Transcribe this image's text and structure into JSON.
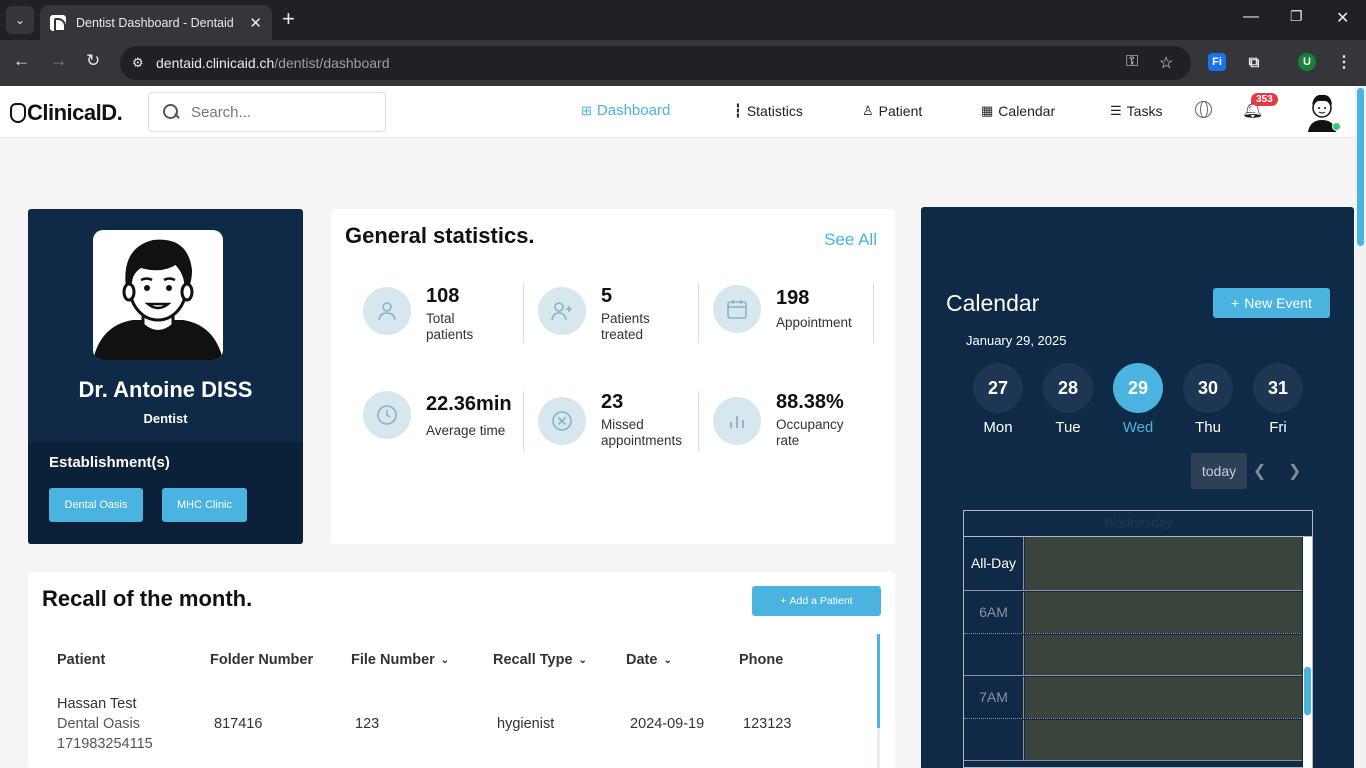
{
  "browser": {
    "tab_title": "Dentist Dashboard - Dentaid",
    "url_host": "dentaid.clinicaid.ch",
    "url_path": "/dentist/dashboard",
    "profile_initial": "U",
    "ext_label": "Fi"
  },
  "header": {
    "logo": "ClinicalD.",
    "search_placeholder": "Search...",
    "nav": [
      "Dashboard",
      "Statistics",
      "Patient",
      "Calendar",
      "Tasks"
    ],
    "notifications": "353"
  },
  "profile": {
    "name": "Dr. Antoine DISS",
    "role": "Dentist",
    "establishments_title": "Establishment(s)",
    "establishments": [
      "Dental Oasis",
      "MHC Clinic"
    ]
  },
  "stats": {
    "title": "General statistics.",
    "see_all": "See All",
    "items": [
      {
        "value": "108",
        "label": "Total patients",
        "icon": "user-icon"
      },
      {
        "value": "5",
        "label": "Patients treated",
        "icon": "user-plus-icon"
      },
      {
        "value": "198",
        "label": "Appointment",
        "icon": "calendar-icon"
      },
      {
        "value": "22.36min",
        "label": "Average time",
        "icon": "clock-icon"
      },
      {
        "value": "23",
        "label": "Missed appointments",
        "icon": "x-circle-icon"
      },
      {
        "value": "88.38%",
        "label": "Occupancy rate",
        "icon": "bar-chart-icon"
      }
    ]
  },
  "calendar": {
    "title": "Calendar",
    "new_event": "New Event",
    "date": "January 29, 2025",
    "days": [
      {
        "num": "27",
        "name": "Mon"
      },
      {
        "num": "28",
        "name": "Tue"
      },
      {
        "num": "29",
        "name": "Wed"
      },
      {
        "num": "30",
        "name": "Thu"
      },
      {
        "num": "31",
        "name": "Fri"
      }
    ],
    "selected_index": 2,
    "today": "today",
    "grid_header": "Wednesday",
    "rows": [
      "All-Day",
      "6AM",
      "",
      "7AM",
      ""
    ]
  },
  "recall": {
    "title": "Recall of the month.",
    "add_patient": "Add a Patient",
    "columns": [
      "Patient",
      "Folder Number",
      "File Number",
      "Recall Type",
      "Date",
      "Phone"
    ],
    "rows": [
      {
        "patient_name": "Hassan Test",
        "patient_clinic": "Dental Oasis",
        "patient_id": "171983254115",
        "folder_number": "817416",
        "file_number": "123",
        "recall_type": "hygienist",
        "date": "2024-09-19",
        "phone": "123123"
      }
    ]
  }
}
